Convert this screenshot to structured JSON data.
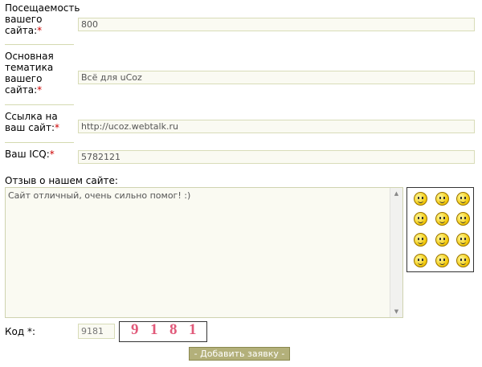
{
  "form": {
    "traffic": {
      "label": "Посещаемость вашего сайта:",
      "required": "*",
      "value": "800"
    },
    "topic": {
      "label": "Основная тематика вашего сайта:",
      "required": "*",
      "value": "Всё для uCoz"
    },
    "link": {
      "label": "Ссылка на ваш сайт:",
      "required": "*",
      "value": "http://ucoz.webtalk.ru"
    },
    "icq": {
      "label": "Ваш ICQ:",
      "required": "*",
      "value": "5782121"
    },
    "review": {
      "label": "Отзыв о нашем сайте:",
      "value": "Сайт отличный, очень сильно помог! :)"
    },
    "captcha": {
      "label": "Код *:",
      "value": "9181",
      "image_text": [
        "9",
        "1",
        "8",
        "1"
      ]
    },
    "submit_label": "- Добавить заявку -"
  },
  "smiles": [
    "angry-smile-icon",
    "grin-smile-icon",
    "cool-smile-icon",
    "shocked-smile-icon",
    "wink-smile-icon",
    "happy-smile-icon",
    "worried-smile-icon",
    "smile-icon",
    "surprised-smile-icon",
    "tongue-smile-icon",
    "blush-smile-icon",
    "smirk-smile-icon"
  ],
  "colors": {
    "required": "#cc0000",
    "button_bg": "#b3b07a",
    "field_border": "#d8dcb8"
  }
}
